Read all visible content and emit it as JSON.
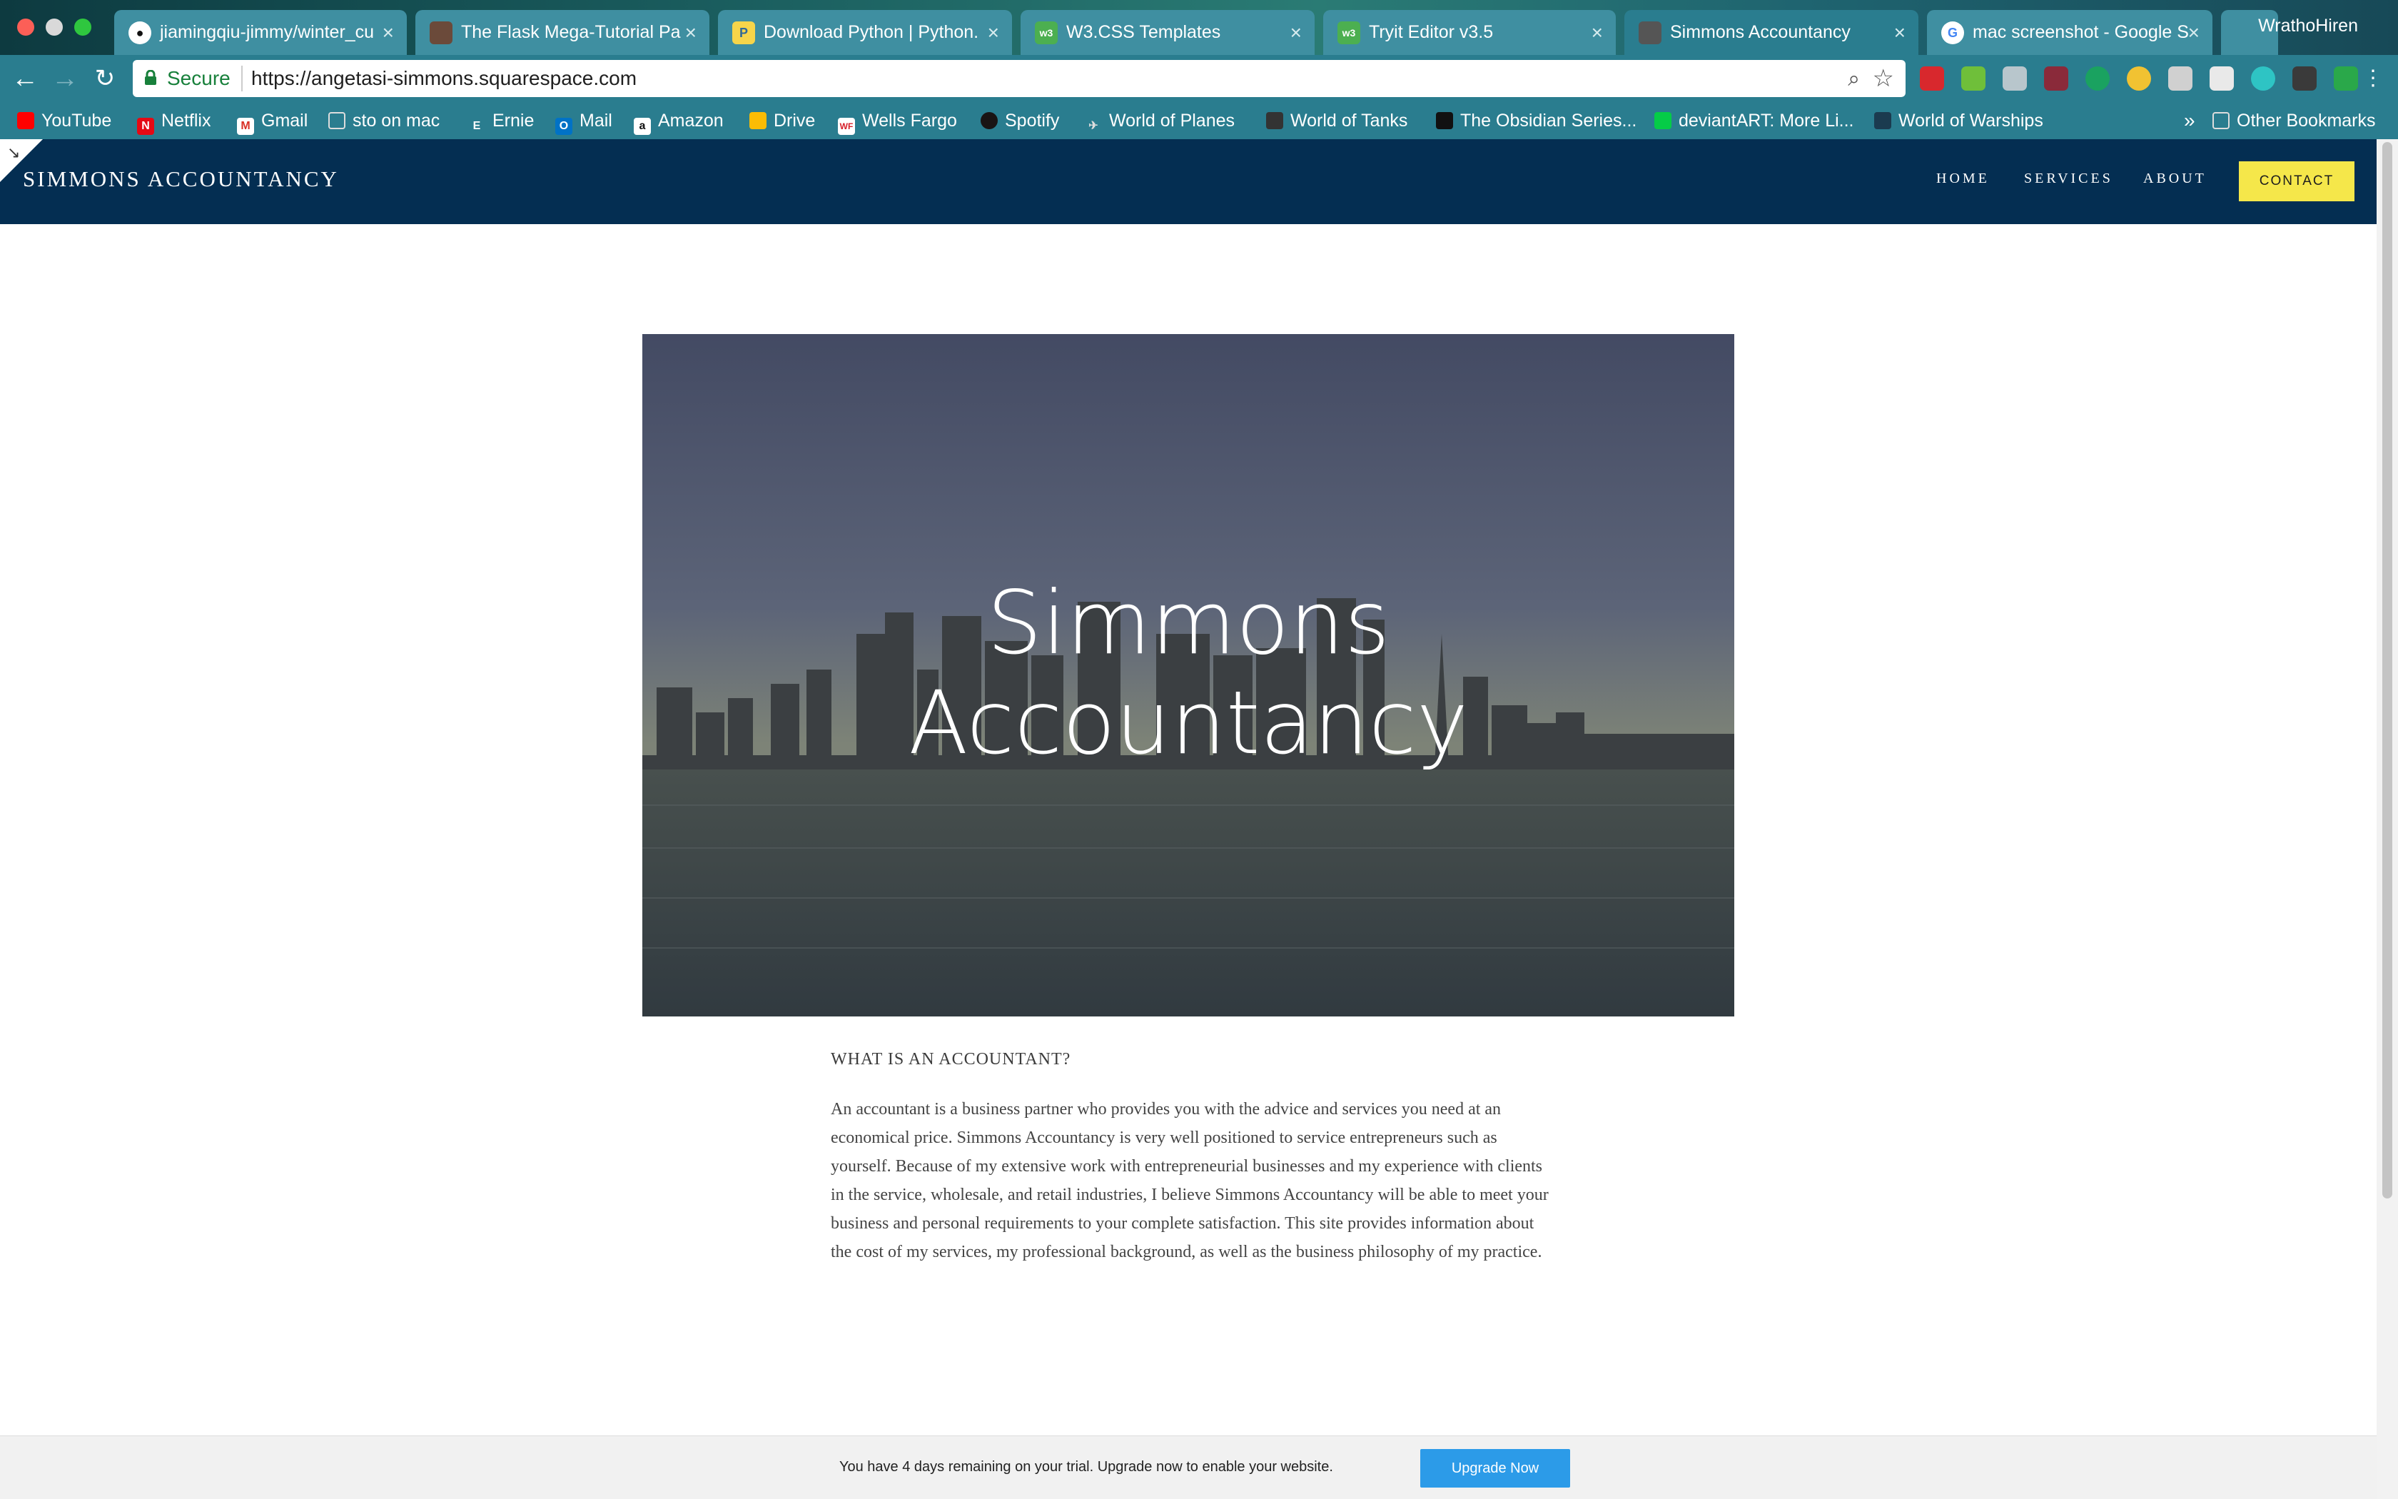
{
  "browser": {
    "tabs": [
      {
        "title": "jiamingqiu-jimmy/winter_cu",
        "icon": "github-icon"
      },
      {
        "title": "The Flask Mega-Tutorial Pa",
        "icon": "avatar-icon"
      },
      {
        "title": "Download Python | Python.",
        "icon": "python-icon"
      },
      {
        "title": "W3.CSS Templates",
        "icon": "w3-icon"
      },
      {
        "title": "Tryit Editor v3.5",
        "icon": "w3-icon"
      },
      {
        "title": "Simmons Accountancy",
        "icon": "squarespace-icon"
      },
      {
        "title": "mac screenshot - Google S",
        "icon": "google-icon"
      }
    ],
    "active_tab": 5,
    "profile_name": "WrathoHiren",
    "secure_label": "Secure",
    "url": "https://angetasi-simmons.squarespace.com",
    "bookmarks": [
      {
        "label": "YouTube",
        "color": "#ff0000"
      },
      {
        "label": "Netflix",
        "color": "#e50914"
      },
      {
        "label": "Gmail",
        "color": "#d93025"
      },
      {
        "label": "sto on mac",
        "color": "#dddddd"
      },
      {
        "label": "Ernie",
        "color": "#ffffff"
      },
      {
        "label": "Mail",
        "color": "#0072c6"
      },
      {
        "label": "Amazon",
        "color": "#ffffff"
      },
      {
        "label": "Drive",
        "color": "#fbbc04"
      },
      {
        "label": "Wells Fargo",
        "color": "#d71e28"
      },
      {
        "label": "Spotify",
        "color": "#191414"
      },
      {
        "label": "World of Planes",
        "color": "#dddddd"
      },
      {
        "label": "World of Tanks",
        "color": "#333333"
      },
      {
        "label": "The Obsidian Series...",
        "color": "#111111"
      },
      {
        "label": "deviantART: More Li...",
        "color": "#05cc47"
      },
      {
        "label": "World of Warships",
        "color": "#1b3b4f"
      }
    ],
    "bookmarks_more": "»",
    "other_bookmarks": "Other Bookmarks"
  },
  "site": {
    "title": "SIMMONS ACCOUNTANCY",
    "nav": {
      "home": "HOME",
      "services": "SERVICES",
      "about": "ABOUT",
      "contact": "CONTACT"
    },
    "hero_title_line1": "Simmons",
    "hero_title_line2": "Accountancy",
    "section_heading": "WHAT IS AN ACCOUNTANT?",
    "section_body": "An accountant is a business partner who provides you with the advice and services you need at an economical price.  Simmons Accountancy is very well positioned to service entrepreneurs such as yourself.  Because of my extensive work with entrepreneurial businesses and my experience with clients in the service, wholesale, and retail industries, I believe Simmons Accountancy will be able to meet your business and personal requirements to your complete satisfaction.  This site provides information about the cost of my services, my professional background, as well as the business philosophy of my practice."
  },
  "trial_bar": {
    "message": "You have 4 days remaining on your trial. Upgrade now to enable your website.",
    "button": "Upgrade Now"
  },
  "colors": {
    "header_bg": "#042e52",
    "contact_bg": "#f5e74a",
    "upgrade_bg": "#2c9be8",
    "chrome_bg": "#2a7d8f"
  }
}
